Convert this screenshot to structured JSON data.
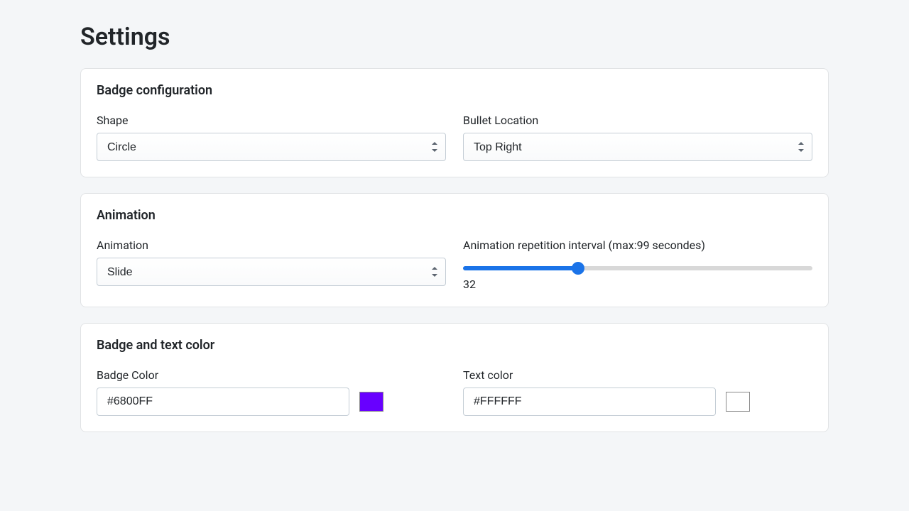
{
  "page": {
    "title": "Settings"
  },
  "badge_config": {
    "title": "Badge configuration",
    "shape": {
      "label": "Shape",
      "value": "Circle"
    },
    "bullet_location": {
      "label": "Bullet Location",
      "value": "Top Right"
    }
  },
  "animation": {
    "title": "Animation",
    "type": {
      "label": "Animation",
      "value": "Slide"
    },
    "interval": {
      "label": "Animation repetition interval (max:99 secondes)",
      "value": "32",
      "min": "0",
      "max": "99"
    }
  },
  "colors": {
    "title": "Badge and text color",
    "badge": {
      "label": "Badge Color",
      "value": "#6800FF",
      "swatch": "#6800FF"
    },
    "text": {
      "label": "Text color",
      "value": "#FFFFFF",
      "swatch": "#FFFFFF"
    }
  }
}
